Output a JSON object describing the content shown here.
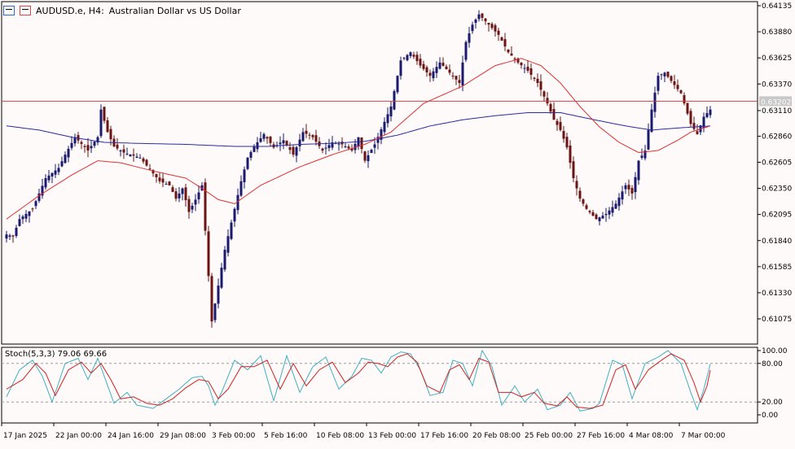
{
  "header": {
    "symbol": "AUDUSD.e, H4:",
    "description": "Australian Dollar vs US Dollar",
    "icons": [
      "chart-grid-icon",
      "chart-candle-icon"
    ]
  },
  "price_axis": {
    "ticks": [
      "0.64135",
      "0.63880",
      "0.63625",
      "0.63370",
      "0.63110",
      "0.62860",
      "0.62605",
      "0.62350",
      "0.62095",
      "0.61840",
      "0.61585",
      "0.61330",
      "0.61075"
    ],
    "current_price": "0.63202"
  },
  "stoch_axis": {
    "ticks": [
      "100.00",
      "80.00",
      "20.00",
      "0.00"
    ]
  },
  "time_axis": {
    "labels": [
      "17 Jan 2025",
      "22 Jan 00:00",
      "24 Jan 16:00",
      "29 Jan 08:00",
      "3 Feb 00:00",
      "5 Feb 16:00",
      "10 Feb 08:00",
      "13 Feb 00:00",
      "17 Feb 16:00",
      "20 Feb 08:00",
      "25 Feb 00:00",
      "27 Feb 16:00",
      "4 Mar 08:00",
      "7 Mar 00:00"
    ]
  },
  "stoch": {
    "label": "Stoch(5,3,3) 79.06 69.66",
    "main_value": 79.06,
    "signal_value": 69.66
  },
  "colors": {
    "background": "#fffafa",
    "bull_candle": "#1a1a6e",
    "bear_candle": "#6b1414",
    "ma_fast": "#e03030",
    "ma_slow": "#2a2aa0",
    "current_price_line": "#d04040",
    "stoch_main": "#3fb0c0",
    "stoch_signal": "#d02020",
    "level_line": "#999999"
  },
  "chart_data": {
    "type": "candlestick",
    "symbol": "AUDUSD.e",
    "timeframe": "H4",
    "ylim": [
      0.6095,
      0.6419
    ],
    "close_path": [
      [
        0,
        0.619
      ],
      [
        2,
        0.6188
      ],
      [
        4,
        0.6205
      ],
      [
        8,
        0.6215
      ],
      [
        12,
        0.6245
      ],
      [
        16,
        0.6255
      ],
      [
        18,
        0.6268
      ],
      [
        21,
        0.6285
      ],
      [
        25,
        0.6272
      ],
      [
        28,
        0.6285
      ],
      [
        29,
        0.6312
      ],
      [
        31,
        0.629
      ],
      [
        33,
        0.6276
      ],
      [
        36,
        0.627
      ],
      [
        41,
        0.6265
      ],
      [
        47,
        0.6242
      ],
      [
        50,
        0.6238
      ],
      [
        52,
        0.6225
      ],
      [
        54,
        0.6235
      ],
      [
        56,
        0.6212
      ],
      [
        58,
        0.6224
      ],
      [
        60,
        0.6238
      ],
      [
        63,
        0.6105
      ],
      [
        65,
        0.614
      ],
      [
        67,
        0.6175
      ],
      [
        70,
        0.6215
      ],
      [
        72,
        0.6242
      ],
      [
        74,
        0.6265
      ],
      [
        76,
        0.6276
      ],
      [
        79,
        0.6288
      ],
      [
        82,
        0.6275
      ],
      [
        85,
        0.6282
      ],
      [
        88,
        0.6268
      ],
      [
        91,
        0.629
      ],
      [
        94,
        0.6285
      ],
      [
        97,
        0.6272
      ],
      [
        100,
        0.628
      ],
      [
        103,
        0.6278
      ],
      [
        106,
        0.6272
      ],
      [
        108,
        0.6285
      ],
      [
        110,
        0.6262
      ],
      [
        113,
        0.6278
      ],
      [
        116,
        0.63
      ],
      [
        118,
        0.6315
      ],
      [
        121,
        0.636
      ],
      [
        124,
        0.6368
      ],
      [
        127,
        0.6355
      ],
      [
        130,
        0.6345
      ],
      [
        133,
        0.6358
      ],
      [
        136,
        0.6348
      ],
      [
        139,
        0.6338
      ],
      [
        141,
        0.6378
      ],
      [
        143,
        0.6395
      ],
      [
        145,
        0.6405
      ],
      [
        148,
        0.6395
      ],
      [
        151,
        0.6385
      ],
      [
        154,
        0.6368
      ],
      [
        157,
        0.6358
      ],
      [
        160,
        0.635
      ],
      [
        163,
        0.6338
      ],
      [
        166,
        0.6318
      ],
      [
        168,
        0.6302
      ],
      [
        170,
        0.6292
      ],
      [
        172,
        0.6275
      ],
      [
        174,
        0.6245
      ],
      [
        176,
        0.6225
      ],
      [
        178,
        0.6215
      ],
      [
        181,
        0.6205
      ],
      [
        184,
        0.621
      ],
      [
        187,
        0.622
      ],
      [
        190,
        0.6238
      ],
      [
        192,
        0.623
      ],
      [
        194,
        0.6262
      ],
      [
        196,
        0.6272
      ],
      [
        198,
        0.6312
      ],
      [
        200,
        0.6345
      ],
      [
        202,
        0.6348
      ],
      [
        204,
        0.634
      ],
      [
        207,
        0.6328
      ],
      [
        210,
        0.6298
      ],
      [
        212,
        0.6288
      ],
      [
        214,
        0.6305
      ],
      [
        216,
        0.6312
      ]
    ],
    "ma_fast_path": [
      [
        0,
        0.6205
      ],
      [
        10,
        0.6228
      ],
      [
        20,
        0.6248
      ],
      [
        28,
        0.6262
      ],
      [
        35,
        0.626
      ],
      [
        45,
        0.6252
      ],
      [
        55,
        0.6245
      ],
      [
        60,
        0.6235
      ],
      [
        65,
        0.6224
      ],
      [
        70,
        0.622
      ],
      [
        78,
        0.6238
      ],
      [
        90,
        0.6256
      ],
      [
        100,
        0.6268
      ],
      [
        110,
        0.6278
      ],
      [
        118,
        0.629
      ],
      [
        128,
        0.6318
      ],
      [
        140,
        0.6335
      ],
      [
        150,
        0.6355
      ],
      [
        158,
        0.6362
      ],
      [
        164,
        0.6355
      ],
      [
        170,
        0.6338
      ],
      [
        176,
        0.6315
      ],
      [
        182,
        0.6295
      ],
      [
        188,
        0.628
      ],
      [
        194,
        0.627
      ],
      [
        200,
        0.6272
      ],
      [
        206,
        0.6282
      ],
      [
        210,
        0.629
      ],
      [
        216,
        0.6296
      ]
    ],
    "ma_slow_path": [
      [
        0,
        0.6296
      ],
      [
        10,
        0.6292
      ],
      [
        20,
        0.6285
      ],
      [
        30,
        0.628
      ],
      [
        40,
        0.6279
      ],
      [
        55,
        0.6278
      ],
      [
        70,
        0.6276
      ],
      [
        80,
        0.6276
      ],
      [
        90,
        0.6278
      ],
      [
        100,
        0.6279
      ],
      [
        110,
        0.6281
      ],
      [
        120,
        0.6287
      ],
      [
        130,
        0.6296
      ],
      [
        140,
        0.6302
      ],
      [
        150,
        0.6306
      ],
      [
        160,
        0.6309
      ],
      [
        170,
        0.6309
      ],
      [
        176,
        0.6305
      ],
      [
        182,
        0.6301
      ],
      [
        190,
        0.6296
      ],
      [
        198,
        0.6292
      ],
      [
        206,
        0.6294
      ],
      [
        216,
        0.6296
      ]
    ],
    "stoch_main_path": [
      [
        0,
        28
      ],
      [
        4,
        70
      ],
      [
        8,
        85
      ],
      [
        11,
        60
      ],
      [
        14,
        20
      ],
      [
        18,
        80
      ],
      [
        22,
        88
      ],
      [
        25,
        55
      ],
      [
        28,
        88
      ],
      [
        30,
        60
      ],
      [
        33,
        18
      ],
      [
        37,
        35
      ],
      [
        40,
        15
      ],
      [
        45,
        10
      ],
      [
        49,
        25
      ],
      [
        53,
        40
      ],
      [
        57,
        58
      ],
      [
        60,
        60
      ],
      [
        62,
        45
      ],
      [
        64,
        15
      ],
      [
        66,
        35
      ],
      [
        70,
        85
      ],
      [
        74,
        70
      ],
      [
        78,
        92
      ],
      [
        82,
        22
      ],
      [
        86,
        92
      ],
      [
        90,
        35
      ],
      [
        94,
        75
      ],
      [
        98,
        90
      ],
      [
        102,
        40
      ],
      [
        106,
        60
      ],
      [
        109,
        88
      ],
      [
        112,
        85
      ],
      [
        115,
        65
      ],
      [
        118,
        90
      ],
      [
        121,
        98
      ],
      [
        124,
        95
      ],
      [
        127,
        70
      ],
      [
        130,
        30
      ],
      [
        134,
        35
      ],
      [
        137,
        85
      ],
      [
        140,
        80
      ],
      [
        143,
        45
      ],
      [
        146,
        100
      ],
      [
        149,
        75
      ],
      [
        152,
        15
      ],
      [
        156,
        45
      ],
      [
        159,
        20
      ],
      [
        163,
        40
      ],
      [
        166,
        8
      ],
      [
        170,
        15
      ],
      [
        173,
        35
      ],
      [
        176,
        6
      ],
      [
        180,
        10
      ],
      [
        182,
        18
      ],
      [
        186,
        85
      ],
      [
        189,
        78
      ],
      [
        192,
        25
      ],
      [
        196,
        80
      ],
      [
        200,
        90
      ],
      [
        203,
        100
      ],
      [
        207,
        80
      ],
      [
        210,
        35
      ],
      [
        212,
        8
      ],
      [
        214,
        40
      ],
      [
        216,
        79.06
      ]
    ],
    "stoch_signal_path": [
      [
        0,
        40
      ],
      [
        5,
        55
      ],
      [
        9,
        80
      ],
      [
        12,
        65
      ],
      [
        15,
        30
      ],
      [
        19,
        70
      ],
      [
        23,
        82
      ],
      [
        26,
        65
      ],
      [
        29,
        80
      ],
      [
        32,
        55
      ],
      [
        35,
        25
      ],
      [
        39,
        28
      ],
      [
        43,
        18
      ],
      [
        47,
        15
      ],
      [
        51,
        25
      ],
      [
        55,
        42
      ],
      [
        59,
        55
      ],
      [
        62,
        52
      ],
      [
        65,
        25
      ],
      [
        68,
        40
      ],
      [
        72,
        75
      ],
      [
        76,
        75
      ],
      [
        80,
        85
      ],
      [
        84,
        40
      ],
      [
        88,
        80
      ],
      [
        92,
        45
      ],
      [
        96,
        70
      ],
      [
        100,
        82
      ],
      [
        104,
        50
      ],
      [
        108,
        65
      ],
      [
        111,
        82
      ],
      [
        114,
        80
      ],
      [
        117,
        75
      ],
      [
        120,
        90
      ],
      [
        123,
        95
      ],
      [
        126,
        82
      ],
      [
        129,
        45
      ],
      [
        133,
        35
      ],
      [
        136,
        70
      ],
      [
        139,
        78
      ],
      [
        142,
        55
      ],
      [
        145,
        88
      ],
      [
        148,
        82
      ],
      [
        151,
        35
      ],
      [
        155,
        35
      ],
      [
        158,
        28
      ],
      [
        162,
        35
      ],
      [
        165,
        18
      ],
      [
        169,
        14
      ],
      [
        172,
        28
      ],
      [
        175,
        12
      ],
      [
        179,
        10
      ],
      [
        183,
        15
      ],
      [
        187,
        70
      ],
      [
        190,
        78
      ],
      [
        193,
        40
      ],
      [
        197,
        70
      ],
      [
        201,
        85
      ],
      [
        204,
        95
      ],
      [
        208,
        85
      ],
      [
        211,
        50
      ],
      [
        213,
        20
      ],
      [
        215,
        45
      ],
      [
        216,
        69.66
      ]
    ]
  }
}
